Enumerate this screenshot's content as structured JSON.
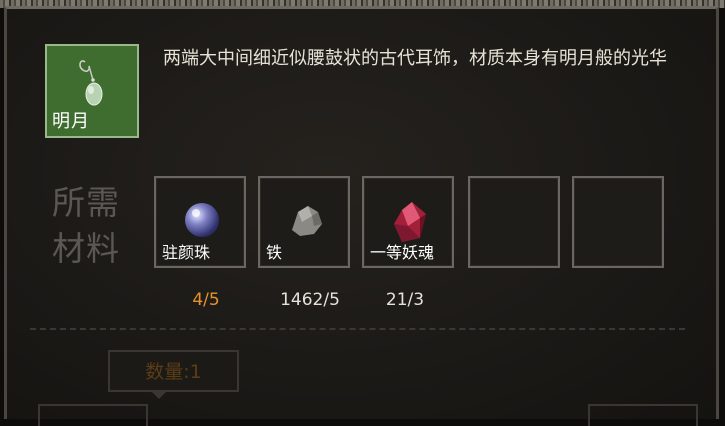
{
  "item": {
    "name": "明月",
    "icon": "jade-earring-icon",
    "description": "两端大中间细近似腰鼓状的古代耳饰，材质本身有明月般的光华"
  },
  "requirements": {
    "label_line1": "所需",
    "label_line2": "材料",
    "materials": [
      {
        "name": "驻颜珠",
        "icon": "pearl-orb-icon",
        "count": "4/5",
        "insufficient": true
      },
      {
        "name": "铁",
        "icon": "iron-ore-icon",
        "count": "1462/5",
        "insufficient": false
      },
      {
        "name": "一等妖魂",
        "icon": "red-crystal-icon",
        "count": "21/3",
        "insufficient": false
      },
      {
        "name": "",
        "icon": "",
        "count": "",
        "insufficient": false
      },
      {
        "name": "",
        "icon": "",
        "count": "",
        "insufficient": false
      }
    ]
  },
  "quantity": {
    "label": "数量:1"
  },
  "colors": {
    "insufficient": "#e8912c",
    "item_bg": "#3e6d2f"
  }
}
